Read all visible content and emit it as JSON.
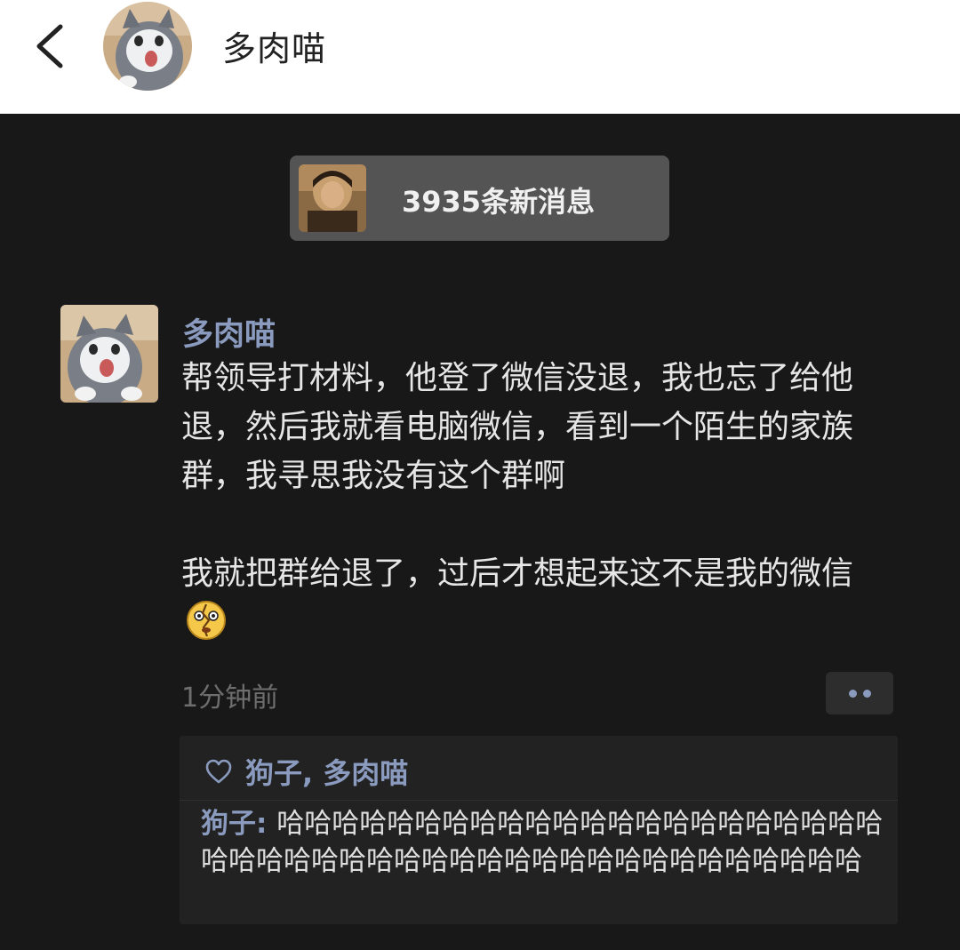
{
  "header": {
    "title": "多肉喵",
    "back_icon": "chevron-left-icon",
    "avatar_icon": "cat-avatar"
  },
  "new_messages": {
    "label": "3935条新消息",
    "avatar_icon": "man-avatar"
  },
  "post": {
    "author": "多肉喵",
    "avatar_icon": "cat-avatar",
    "paragraph1": "帮领导打材料，他登了微信没退，我也忘了给他退，然后我就看电脑微信，看到一个陌生的家族群，我寻思我没有这个群啊",
    "paragraph2": "我就把群给退了，过后才想起来这不是我的微信",
    "emoji_icon": "broken-heart-face-emoji",
    "timestamp": "1分钟前",
    "more_icon": "more-dots-icon"
  },
  "interactions": {
    "like_icon": "heart-icon",
    "likes": "狗子, 多肉喵",
    "comments": [
      {
        "author": "狗子",
        "separator": ": ",
        "text": "哈哈哈哈哈哈哈哈哈哈哈哈哈哈哈哈哈哈哈哈哈哈哈哈哈哈哈哈哈哈哈哈哈哈哈哈哈哈哈哈哈哈哈哈哈哈"
      }
    ]
  },
  "colors": {
    "background_dark": "#181818",
    "nickname_blue": "#8a9bbf",
    "body_text": "#e6e6e6",
    "timestamp_gray": "#6e6e6e",
    "interaction_panel": "#222222",
    "new_msg_pill": "#545454"
  }
}
